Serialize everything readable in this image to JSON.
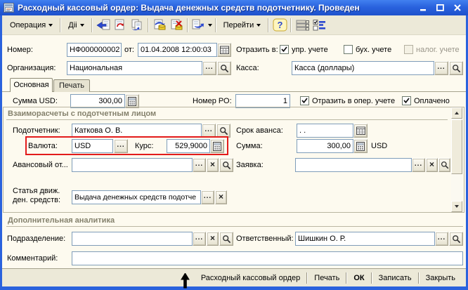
{
  "window": {
    "title": "Расходный кассовый ордер: Выдача денежных средств подотчетнику. Проведен",
    "title_color": "#ffffff",
    "titlebar_color": "#2A63DE"
  },
  "toolbar": {
    "operation_menu": "Операция",
    "actions_menu": "Дii",
    "goto_menu": "Перейти",
    "icons": [
      "back-icon",
      "refresh-icon",
      "copy-icon",
      "post-icon",
      "unpost-icon",
      "based-on-icon",
      "help-icon",
      "list-settings-icon",
      "flags-settings-icon"
    ]
  },
  "header": {
    "number_label": "Номер:",
    "number": "НФ000000002",
    "date_label": "от:",
    "date": "01.04.2008 12:00:03",
    "reflect_label": "Отразить в:",
    "reflect_options": [
      {
        "label": "упр. учете",
        "checked": true,
        "disabled": false
      },
      {
        "label": "бух. учете",
        "checked": false,
        "disabled": false
      },
      {
        "label": "налог. учете",
        "checked": false,
        "disabled": true
      }
    ],
    "org_label": "Организация:",
    "org": "Национальная",
    "kassa_label": "Касса:",
    "kassa": "Касса (доллары)"
  },
  "tabs": [
    {
      "label": "Основная",
      "active": true
    },
    {
      "label": "Печать",
      "active": false
    }
  ],
  "main": {
    "sum_usd_label": "Сумма USD:",
    "sum_usd": "300,00",
    "ro_label": "Номер РО:",
    "ro": "1",
    "oper_cb_label": "Отразить в опер. учете",
    "oper_cb_checked": true,
    "paid_cb_label": "Оплачено",
    "paid_cb_checked": true,
    "group1_title": "Взаиморасчеты с подотчетным лицом",
    "podotchetnik_label": "Подотчетник:",
    "podotchetnik": "Каткова О. В.",
    "srok_label": "Срок аванса:",
    "srok": " .  .",
    "currency_label": "Валюта:",
    "currency": "USD",
    "rate_label": "Курс:",
    "rate": "529,9000",
    "amount_label": "Сумма:",
    "amount": "300,00",
    "amount_currency": "USD",
    "advance_label": "Авансовый от...",
    "advance": "",
    "request_label": "Заявка:",
    "request": "",
    "cashflow_label_line1": "Статья движ.",
    "cashflow_label_line2": "ден. средств:",
    "cashflow": "Выдача денежных средств подотче",
    "group2_title": "Дополнительная аналитика",
    "department_label": "Подразделение:",
    "department": "",
    "responsible_label": "Ответственный:",
    "responsible": "Шишкин О. Р.",
    "comment_label": "Комментарий:",
    "comment": ""
  },
  "footer": {
    "buttons": [
      "Расходный кассовый ордер",
      "Печать",
      "ОК",
      "Записать",
      "Закрыть"
    ]
  },
  "colors": {
    "window_border": "#2A62DD",
    "form_background": "#FDFAEF",
    "toolbar_background": "#ECE9D8",
    "error_highlight": "#E31B1B"
  }
}
